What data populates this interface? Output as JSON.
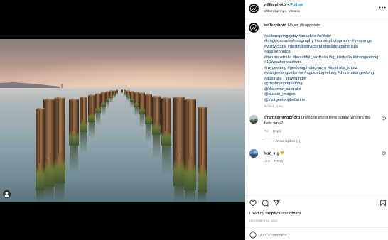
{
  "post": {
    "author": "willkephoto",
    "separator": "•",
    "follow_label": "Follow",
    "location": "Clifton Springs, Victoria"
  },
  "caption": {
    "author": "willkephoto",
    "text": "Never disappoints.",
    "tag_lines": [
      [
        "#cliftonspringsjetty",
        "#coastlife",
        "#oldpier"
      ],
      [
        "#longexposurephotography",
        "#sunsetphotography",
        "#yesyangs"
      ],
      [
        "#visitvictoria",
        "#destinationvictoria",
        "#bellarinepeninsula"
      ],
      [
        "#aussiephotos"
      ],
      [
        "#focusaustralia",
        "#beautiful_australia",
        "#ig_australia",
        "#snapgeelong"
      ],
      [
        "#10weatherwatchers"
      ],
      [
        "#mygeelong",
        "#geelongphotography",
        "#australia_shotz"
      ],
      [
        "#visitgeelongbellarine",
        "#aguidetogeelong",
        "#destinationgeelong"
      ],
      [
        "#australia__downunder"
      ],
      [
        "@destinationgeelong"
      ],
      [
        "@discover_australia"
      ],
      [
        "@aussie_images"
      ],
      [
        "@visitgeelongbellarine"
      ]
    ],
    "meta": "Edited · 16w"
  },
  "comments": [
    {
      "author": "grantflemingphoto",
      "text": "I need to shoot here again! When's the best time?",
      "time": "7w",
      "reply_label": "Reply"
    },
    {
      "author": "kaz_ing",
      "emoji": "orange-heart",
      "time": "11w",
      "reply_label": "Reply"
    }
  ],
  "view_replies_label": "View replies (1)",
  "likes": {
    "prefix": "Liked by",
    "user": "filups79",
    "joiner": "and",
    "others": "others"
  },
  "date": "DECEMBER 10, 2021",
  "add_comment": {
    "placeholder": "Add a comment..."
  },
  "icons": {
    "more": "more-options-icon",
    "like": "heart-icon",
    "comment": "comment-icon",
    "share": "send-icon",
    "save": "bookmark-icon",
    "emoji": "smiley-icon",
    "tagged": "user-icon",
    "comment_like": "heart-icon"
  },
  "colors": {
    "text": "#262626",
    "muted": "#8e8e8e",
    "link": "#00376b",
    "follow": "#0095f6",
    "divider": "#efefef",
    "emoji": "#f59f1b"
  }
}
